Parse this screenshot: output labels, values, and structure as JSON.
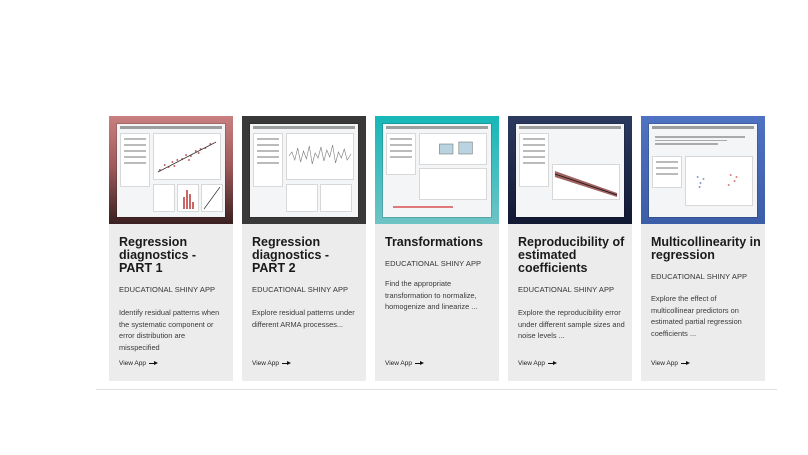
{
  "cards": [
    {
      "title": "Regression diagnostics - PART 1",
      "subtitle": "EDUCATIONAL SHINY APP",
      "description": "Identify residual patterns when the systematic component or error distribution are misspecified",
      "link": "View App",
      "thumb_colors": [
        "#c97f7f",
        "#3a2021"
      ]
    },
    {
      "title": "Regression diagnostics - PART 2",
      "subtitle": "EDUCATIONAL SHINY APP",
      "description": "Explore residual patterns under different ARMA processes...",
      "link": "View App",
      "thumb_colors": [
        "#3d3d3d",
        "#2a2a2a"
      ]
    },
    {
      "title": "Transformations",
      "subtitle": "EDUCATIONAL SHINY APP",
      "description": "Find the appropriate transformation to normalize, homogenize and linearize ...",
      "link": "View App",
      "thumb_colors": [
        "#17b7b8",
        "#6fc3c5"
      ]
    },
    {
      "title": "Reproducibility of estimated coefficients",
      "subtitle": "EDUCATIONAL SHINY APP",
      "description": "Explore the reproducibility error under different sample sizes and noise levels ...",
      "link": "View App",
      "thumb_colors": [
        "#2c3a60",
        "#111933"
      ]
    },
    {
      "title": "Multicollinearity in regression",
      "subtitle": "EDUCATIONAL SHINY APP",
      "description": "Explore the effect of multicollinear predictors on estimated partial regression coefficients ...",
      "link": "View App",
      "thumb_colors": [
        "#4f72c2",
        "#3c5da8"
      ]
    }
  ]
}
